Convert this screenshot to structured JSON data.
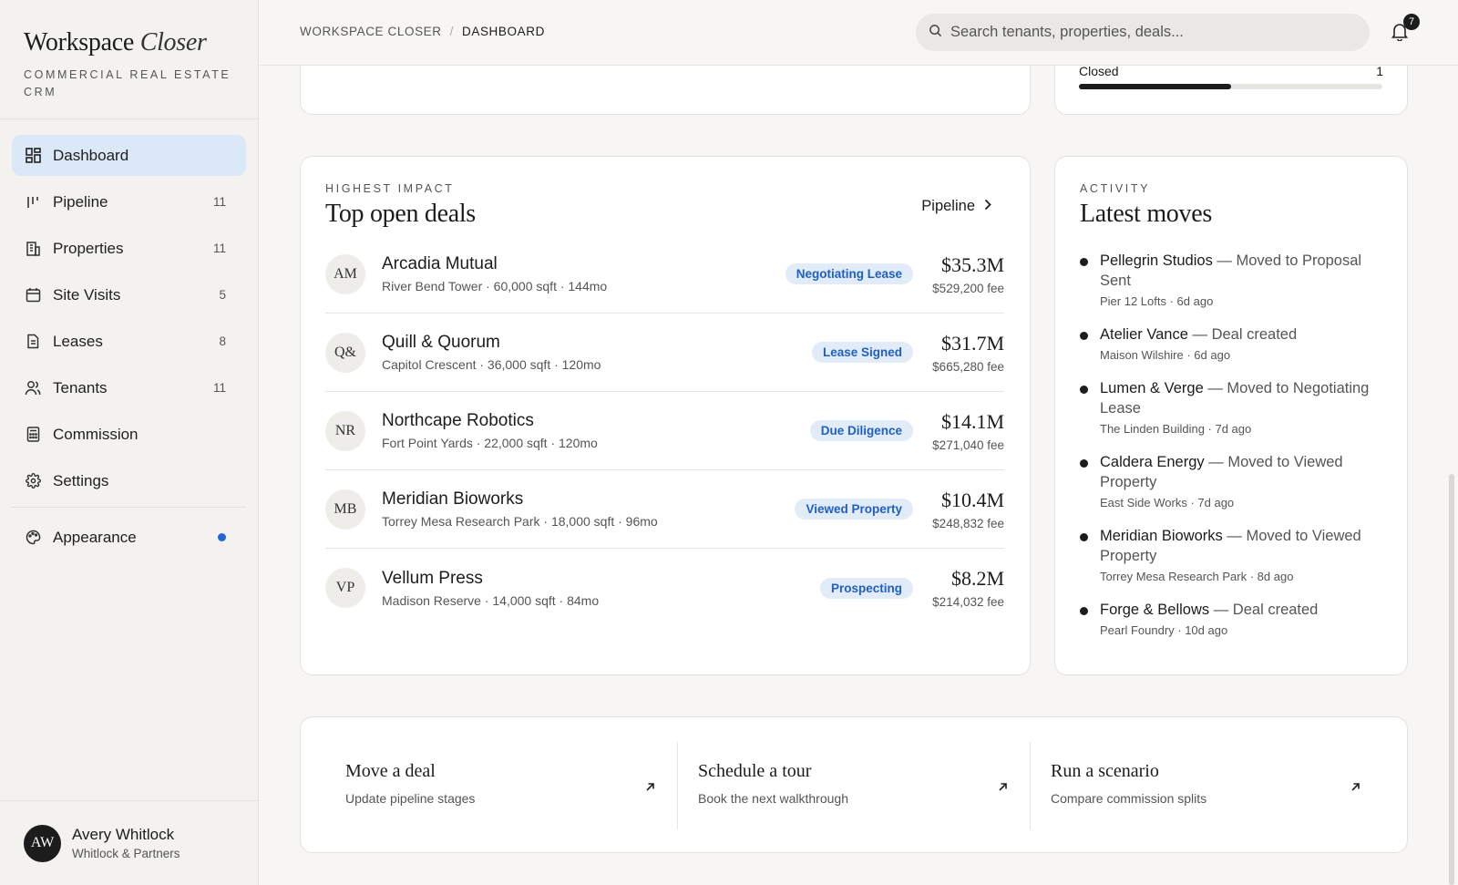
{
  "brand": {
    "name": "Workspace",
    "name_italic": "Closer",
    "subtitle": "Commercial Real Estate CRM"
  },
  "nav": {
    "items": [
      {
        "label": "Dashboard",
        "count": "",
        "icon": "dashboard-icon"
      },
      {
        "label": "Pipeline",
        "count": "11",
        "icon": "pipeline-icon"
      },
      {
        "label": "Properties",
        "count": "11",
        "icon": "building-icon"
      },
      {
        "label": "Site Visits",
        "count": "5",
        "icon": "calendar-icon"
      },
      {
        "label": "Leases",
        "count": "8",
        "icon": "document-icon"
      },
      {
        "label": "Tenants",
        "count": "11",
        "icon": "users-icon"
      },
      {
        "label": "Commission",
        "count": "",
        "icon": "calculator-icon"
      },
      {
        "label": "Settings",
        "count": "",
        "icon": "gear-icon"
      }
    ],
    "appearance": {
      "label": "Appearance",
      "icon": "palette-icon"
    }
  },
  "user": {
    "initials": "AW",
    "name": "Avery Whitlock",
    "org": "Whitlock & Partners"
  },
  "topbar": {
    "breadcrumb": [
      "WORKSPACE CLOSER",
      "DASHBOARD"
    ],
    "search_placeholder": "Search tenants, properties, deals...",
    "notifications": "7"
  },
  "status": {
    "label": "Closed",
    "value": "1",
    "progress": 0.5
  },
  "deals": {
    "eyebrow": "Highest impact",
    "title": "Top open deals",
    "link": "Pipeline",
    "rows": [
      {
        "initials": "AM",
        "name": "Arcadia Mutual",
        "meta": "River Bend Tower · 60,000 sqft · 144mo",
        "stage": "Negotiating Lease",
        "amount": "$35.3M",
        "fee": "$529,200 fee"
      },
      {
        "initials": "Q&",
        "name": "Quill & Quorum",
        "meta": "Capitol Crescent · 36,000 sqft · 120mo",
        "stage": "Lease Signed",
        "amount": "$31.7M",
        "fee": "$665,280 fee"
      },
      {
        "initials": "NR",
        "name": "Northcape Robotics",
        "meta": "Fort Point Yards · 22,000 sqft · 120mo",
        "stage": "Due Diligence",
        "amount": "$14.1M",
        "fee": "$271,040 fee"
      },
      {
        "initials": "MB",
        "name": "Meridian Bioworks",
        "meta": "Torrey Mesa Research Park · 18,000 sqft · 96mo",
        "stage": "Viewed Property",
        "amount": "$10.4M",
        "fee": "$248,832 fee"
      },
      {
        "initials": "VP",
        "name": "Vellum Press",
        "meta": "Madison Reserve · 14,000 sqft · 84mo",
        "stage": "Prospecting",
        "amount": "$8.2M",
        "fee": "$214,032 fee"
      }
    ]
  },
  "activity": {
    "eyebrow": "Activity",
    "title": "Latest moves",
    "items": [
      {
        "name": "Pellegrin Studios",
        "action": " — Moved to Proposal Sent",
        "sub": "Pier 12 Lofts · 6d ago"
      },
      {
        "name": "Atelier Vance",
        "action": " — Deal created",
        "sub": "Maison Wilshire · 6d ago"
      },
      {
        "name": "Lumen & Verge",
        "action": " — Moved to Negotiating Lease",
        "sub": "The Linden Building · 7d ago"
      },
      {
        "name": "Caldera Energy",
        "action": " — Moved to Viewed Property",
        "sub": "East Side Works · 7d ago"
      },
      {
        "name": "Meridian Bioworks",
        "action": " — Moved to Viewed Property",
        "sub": "Torrey Mesa Research Park · 8d ago"
      },
      {
        "name": "Forge & Bellows",
        "action": " — Deal created",
        "sub": "Pearl Foundry · 10d ago"
      }
    ]
  },
  "quick_actions": [
    {
      "title": "Move a deal",
      "sub": "Update pipeline stages"
    },
    {
      "title": "Schedule a tour",
      "sub": "Book the next walkthrough"
    },
    {
      "title": "Run a scenario",
      "sub": "Compare commission splits"
    }
  ]
}
